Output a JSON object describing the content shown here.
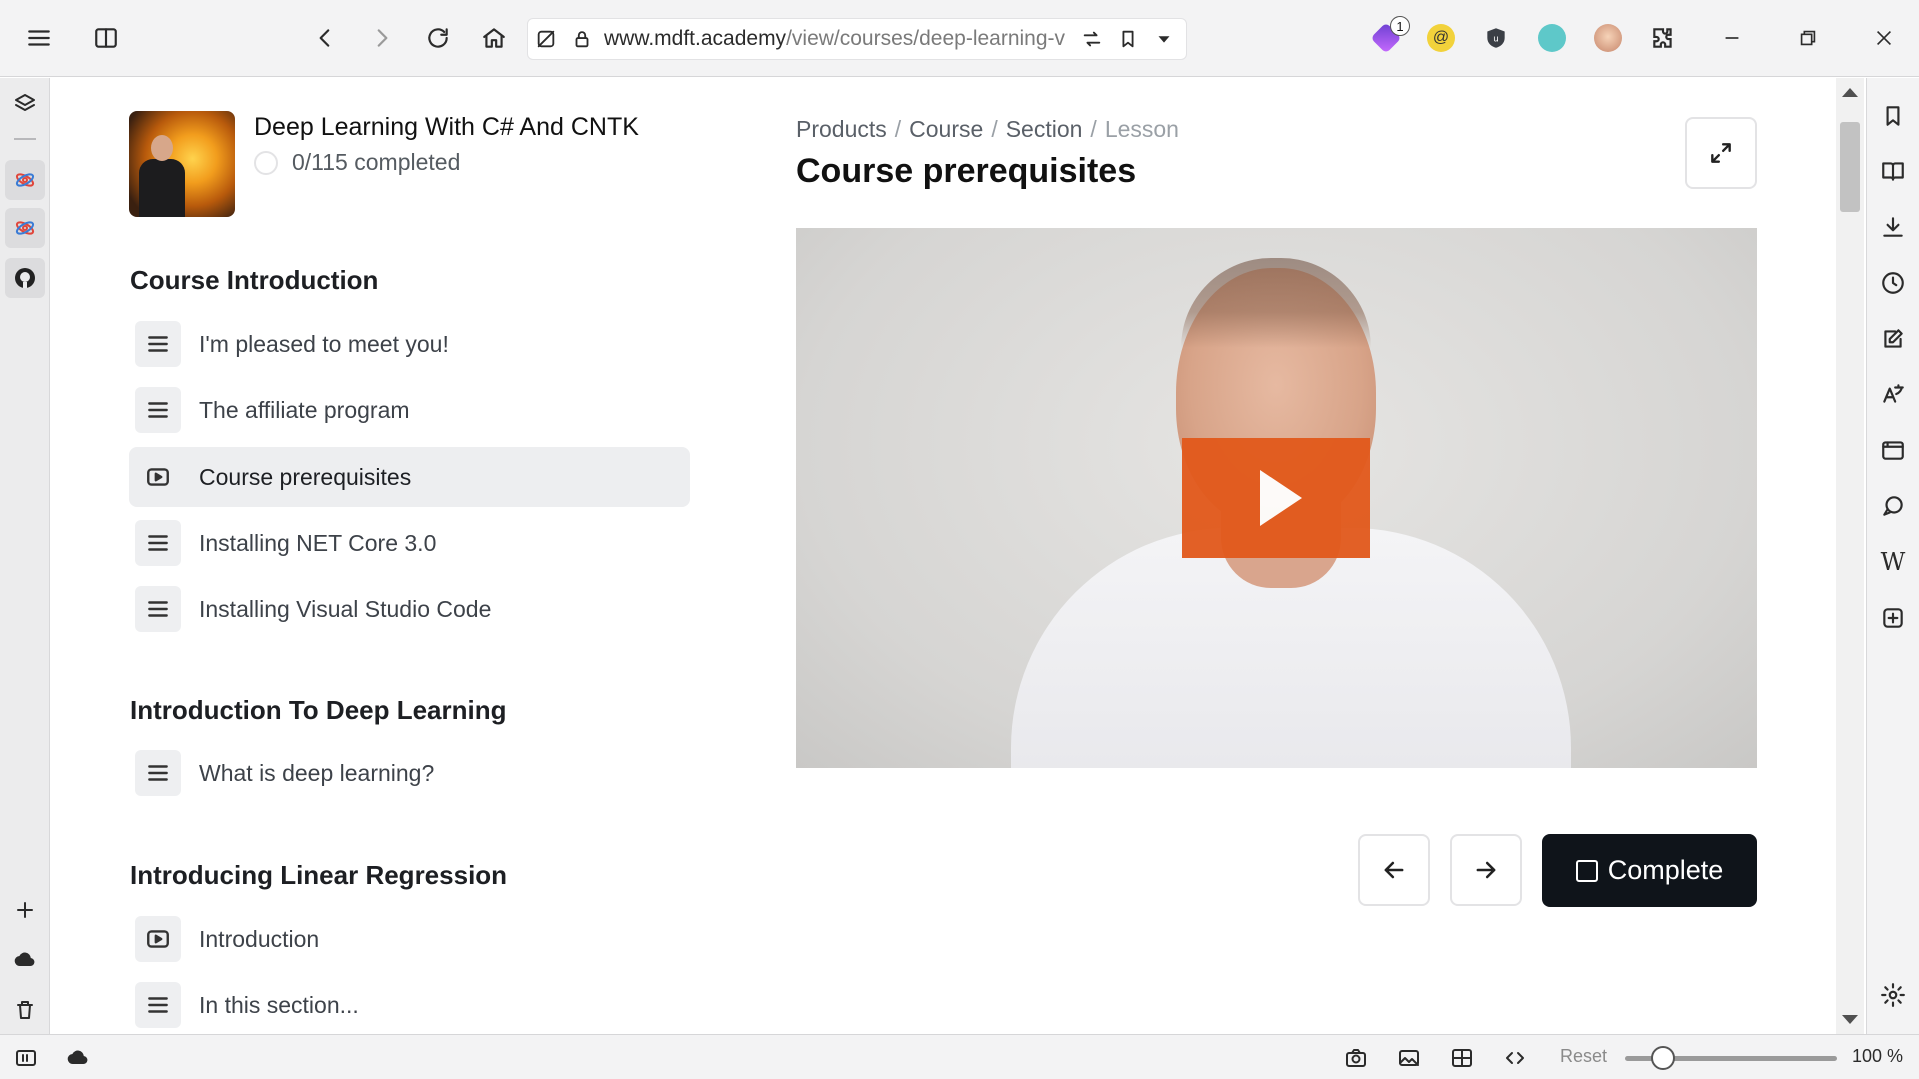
{
  "browser": {
    "url_domain": "www.mdft.academy",
    "url_path": "/view/courses/deep-learning-v",
    "extension_badge": "1",
    "zoom_reset_label": "Reset",
    "zoom_percent": "100 %",
    "zoom_level": 1.0
  },
  "course": {
    "title": "Deep Learning With C# And CNTK",
    "progress": "0/115 completed"
  },
  "sections": [
    {
      "title": "Course Introduction",
      "lessons": [
        {
          "label": "I'm pleased to meet you!",
          "icon": "text-lines-icon"
        },
        {
          "label": "The affiliate program",
          "icon": "text-lines-icon"
        },
        {
          "label": "Course prerequisites",
          "icon": "video-play-icon",
          "active": true
        },
        {
          "label": "Installing NET Core 3.0",
          "icon": "text-lines-icon"
        },
        {
          "label": "Installing Visual Studio Code",
          "icon": "text-lines-icon"
        }
      ]
    },
    {
      "title": "Introduction To Deep Learning",
      "lessons": [
        {
          "label": "What is deep learning?",
          "icon": "text-lines-icon"
        }
      ]
    },
    {
      "title": "Introducing Linear Regression",
      "lessons": [
        {
          "label": "Introduction",
          "icon": "video-play-icon"
        },
        {
          "label": "In this section...",
          "icon": "text-lines-icon"
        }
      ]
    }
  ],
  "breadcrumb": {
    "items": [
      "Products",
      "Course",
      "Section"
    ],
    "current": "Lesson",
    "separator": "/"
  },
  "lesson": {
    "title": "Course prerequisites",
    "complete_label": "Complete"
  },
  "colors": {
    "play_button": "#e2591b",
    "complete_button": "#0f141a",
    "active_lesson_bg": "#edeef0"
  }
}
